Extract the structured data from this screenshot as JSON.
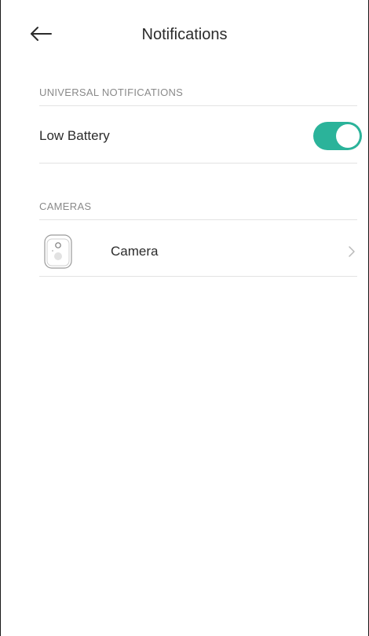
{
  "header": {
    "title": "Notifications",
    "back_icon": "arrow-left-icon"
  },
  "sections": {
    "universal": {
      "title": "UNIVERSAL NOTIFICATIONS",
      "items": [
        {
          "label": "Low Battery",
          "toggle_on": true
        }
      ]
    },
    "cameras": {
      "title": "CAMERAS",
      "items": [
        {
          "label": "Camera",
          "icon": "camera-device-icon",
          "trailing_icon": "chevron-right-icon"
        }
      ]
    }
  },
  "colors": {
    "accent": "#2bb39a",
    "text": "#2b2b2b",
    "section_text": "#8a8a8a",
    "divider": "#e3e3e3",
    "chevron": "#b9b9b9"
  }
}
